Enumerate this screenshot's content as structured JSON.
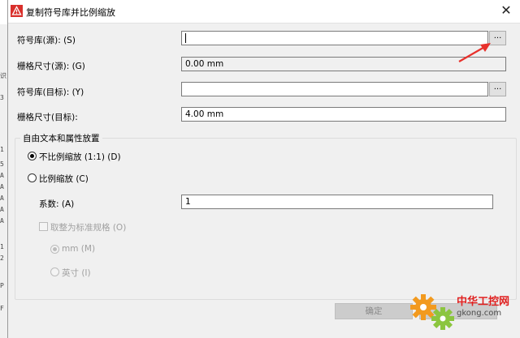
{
  "background_window": {
    "fragments": [
      "识",
      "3",
      "1",
      "5",
      "A",
      "A",
      "A",
      "A",
      "A",
      "1",
      "2",
      "P",
      "F"
    ]
  },
  "dialog": {
    "title": "复制符号库并比例缩放",
    "close_glyph": "✕"
  },
  "fields": {
    "source_library": {
      "label": "符号库(源): (S)",
      "value": "",
      "browse_label": "..."
    },
    "source_grid": {
      "label": "栅格尺寸(源): (G)",
      "value": "0.00 mm"
    },
    "target_library": {
      "label": "符号库(目标): (Y)",
      "value": "",
      "browse_label": "..."
    },
    "target_grid": {
      "label": "栅格尺寸(目标):",
      "value": "4.00 mm"
    }
  },
  "group": {
    "title": "自由文本和属性放置",
    "no_scale": {
      "label": "不比例缩放 (1:1) (D)",
      "checked": true
    },
    "scale": {
      "label": "比例缩放 (C)",
      "checked": false
    },
    "factor": {
      "label": "系数: (A)",
      "value": "1"
    },
    "round": {
      "label": "取整为标准规格 (O)",
      "checked": false,
      "enabled": false
    },
    "unit_mm": {
      "label": "mm (M)",
      "checked": true,
      "enabled": false
    },
    "unit_inch": {
      "label": "英寸 (I)",
      "checked": false,
      "enabled": false
    }
  },
  "buttons": {
    "ok": "确定"
  },
  "watermark": {
    "brand": "中华工控网",
    "url": "gkong.com"
  },
  "colors": {
    "annotation_arrow": "#e8312c",
    "app_icon": "#d9302c"
  }
}
